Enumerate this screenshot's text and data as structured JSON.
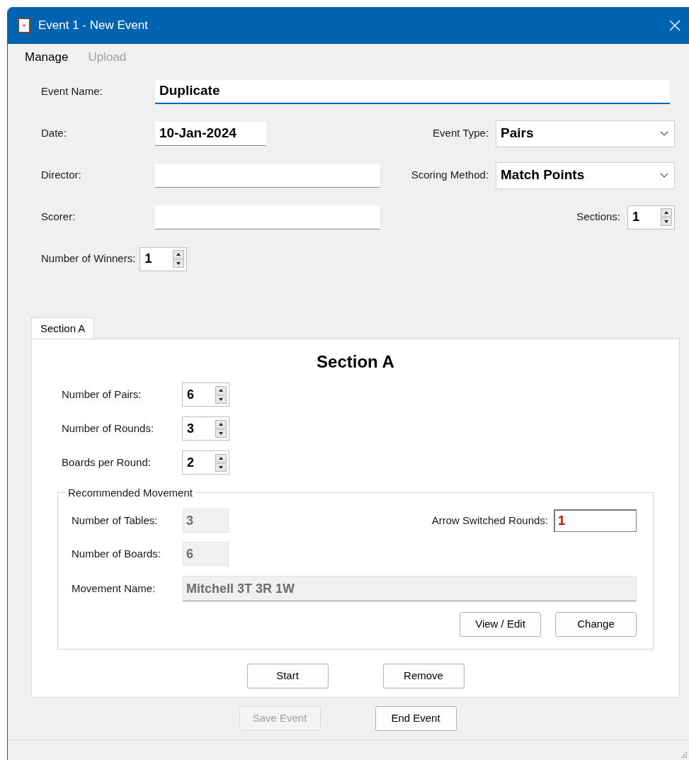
{
  "window": {
    "title": "Event 1 - New Event"
  },
  "menu": [
    {
      "label": "Manage",
      "disabled": false
    },
    {
      "label": "Upload",
      "disabled": true
    }
  ],
  "event_name": {
    "label": "Event Name:",
    "value": "Duplicate",
    "focused": true
  },
  "date": {
    "label": "Date:",
    "value": "10-Jan-2024"
  },
  "event_type": {
    "label": "Event Type:",
    "value": "Pairs"
  },
  "director": {
    "label": "Director:"
  },
  "scoring_method": {
    "label": "Scoring Method:",
    "value": "Match Points"
  },
  "scorer": {
    "label": "Scorer:"
  },
  "sections": {
    "label": "Sections:",
    "value": "1"
  },
  "winners": {
    "label": "Number of Winners:",
    "value": "1"
  },
  "tabs": [
    {
      "label": "Section A",
      "selected": true
    }
  ],
  "section": {
    "heading": "Section A",
    "spinners": [
      {
        "label": "Number of Pairs:",
        "value": "6"
      },
      {
        "label": "Number of Rounds:",
        "value": "3"
      },
      {
        "label": "Boards per Round:",
        "value": "2"
      }
    ],
    "movement": {
      "legend": "Recommended Movement",
      "tables": {
        "label": "Number of Tables:",
        "value": "3"
      },
      "arrow_switched": {
        "label": "Arrow Switched Rounds:",
        "value": "1"
      },
      "boards": {
        "label": "Number of Boards:",
        "value": "6"
      },
      "name": {
        "label": "Movement Name:",
        "value": "Mitchell 3T 3R 1W"
      },
      "buttons": [
        {
          "label": "View / Edit",
          "disabled": false
        },
        {
          "label": "Change",
          "disabled": false
        }
      ]
    },
    "buttons": [
      {
        "label": "Start",
        "disabled": false
      },
      {
        "label": "Remove",
        "disabled": false
      }
    ]
  },
  "footer_buttons": [
    {
      "label": "Save Event",
      "disabled": true
    },
    {
      "label": "End Event",
      "disabled": false
    }
  ]
}
